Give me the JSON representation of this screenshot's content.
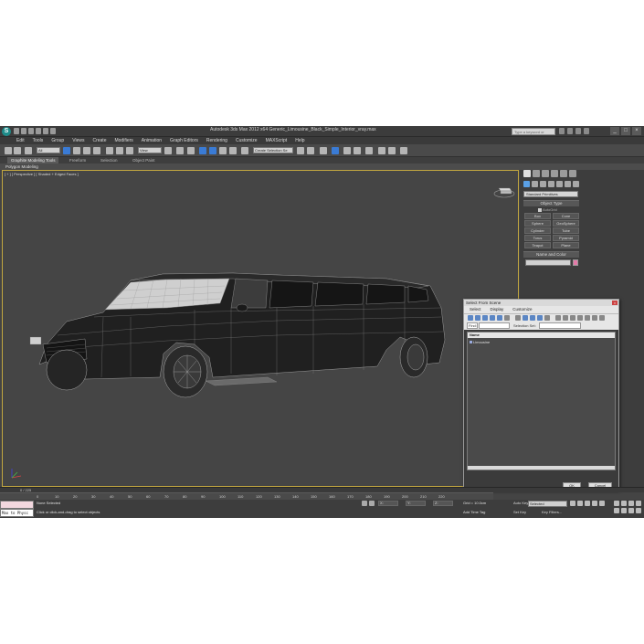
{
  "window": {
    "title": "Autodesk 3ds Max 2012 x64    Generic_Limousine_Black_Simple_Interior_vray.max",
    "search_placeholder": "Type a keyword or phrase",
    "controls": [
      "_",
      "□",
      "×"
    ]
  },
  "menu": [
    "Edit",
    "Tools",
    "Group",
    "Views",
    "Create",
    "Modifiers",
    "Animation",
    "Graph Editors",
    "Rendering",
    "Customize",
    "MAXScript",
    "Help"
  ],
  "toolbar": {
    "filter_all": "All",
    "ref_coord": "View",
    "named_selection": "Create Selection Se"
  },
  "ribbon": {
    "tabs": [
      "Graphite Modeling Tools",
      "Freeform",
      "Selection",
      "Object Paint"
    ],
    "active_tab": 0,
    "subtitle": "Polygon Modeling"
  },
  "viewport": {
    "label": "[ + ] [ Perspective ] [ Shaded + Edged Faces ]",
    "accent_border": "#c2a740"
  },
  "command_panel": {
    "dropdown": "Standard Primitives",
    "object_type_title": "Object Type",
    "autogrid": "AutoGrid",
    "primitives": [
      "Box",
      "Cone",
      "Sphere",
      "GeoSphere",
      "Cylinder",
      "Tube",
      "Torus",
      "Pyramid",
      "Teapot",
      "Plane"
    ],
    "name_color_title": "Name and Color",
    "swatch_color": "#e47aa8"
  },
  "dialog": {
    "title": "Select From Scene",
    "close": "×",
    "menu": [
      "Select",
      "Display",
      "Customize"
    ],
    "find_label": "Find:",
    "selection_set_label": "Selection Set:",
    "list_header": "Name",
    "items": [
      "Limousine"
    ],
    "ok": "OK",
    "cancel": "Cancel"
  },
  "timeline": {
    "frame": "0 / 225",
    "ticks": [
      "0",
      "10",
      "20",
      "30",
      "40",
      "50",
      "60",
      "70",
      "80",
      "90",
      "100",
      "110",
      "120",
      "130",
      "140",
      "150",
      "160",
      "170",
      "180",
      "190",
      "200",
      "210",
      "220"
    ]
  },
  "status": {
    "maxscript": "Max to Physc",
    "selection": "None Selected",
    "prompt": "Click or click-and-drag to select objects",
    "coords": [
      "X:",
      "Y:",
      "Z:"
    ],
    "grid": "Grid = 10.0cm",
    "add_time_tag": "Add Time Tag",
    "auto_key": "Auto Key",
    "auto_key_mode": "Selected",
    "set_key": "Set Key",
    "key_filters": "Key Filters..."
  }
}
